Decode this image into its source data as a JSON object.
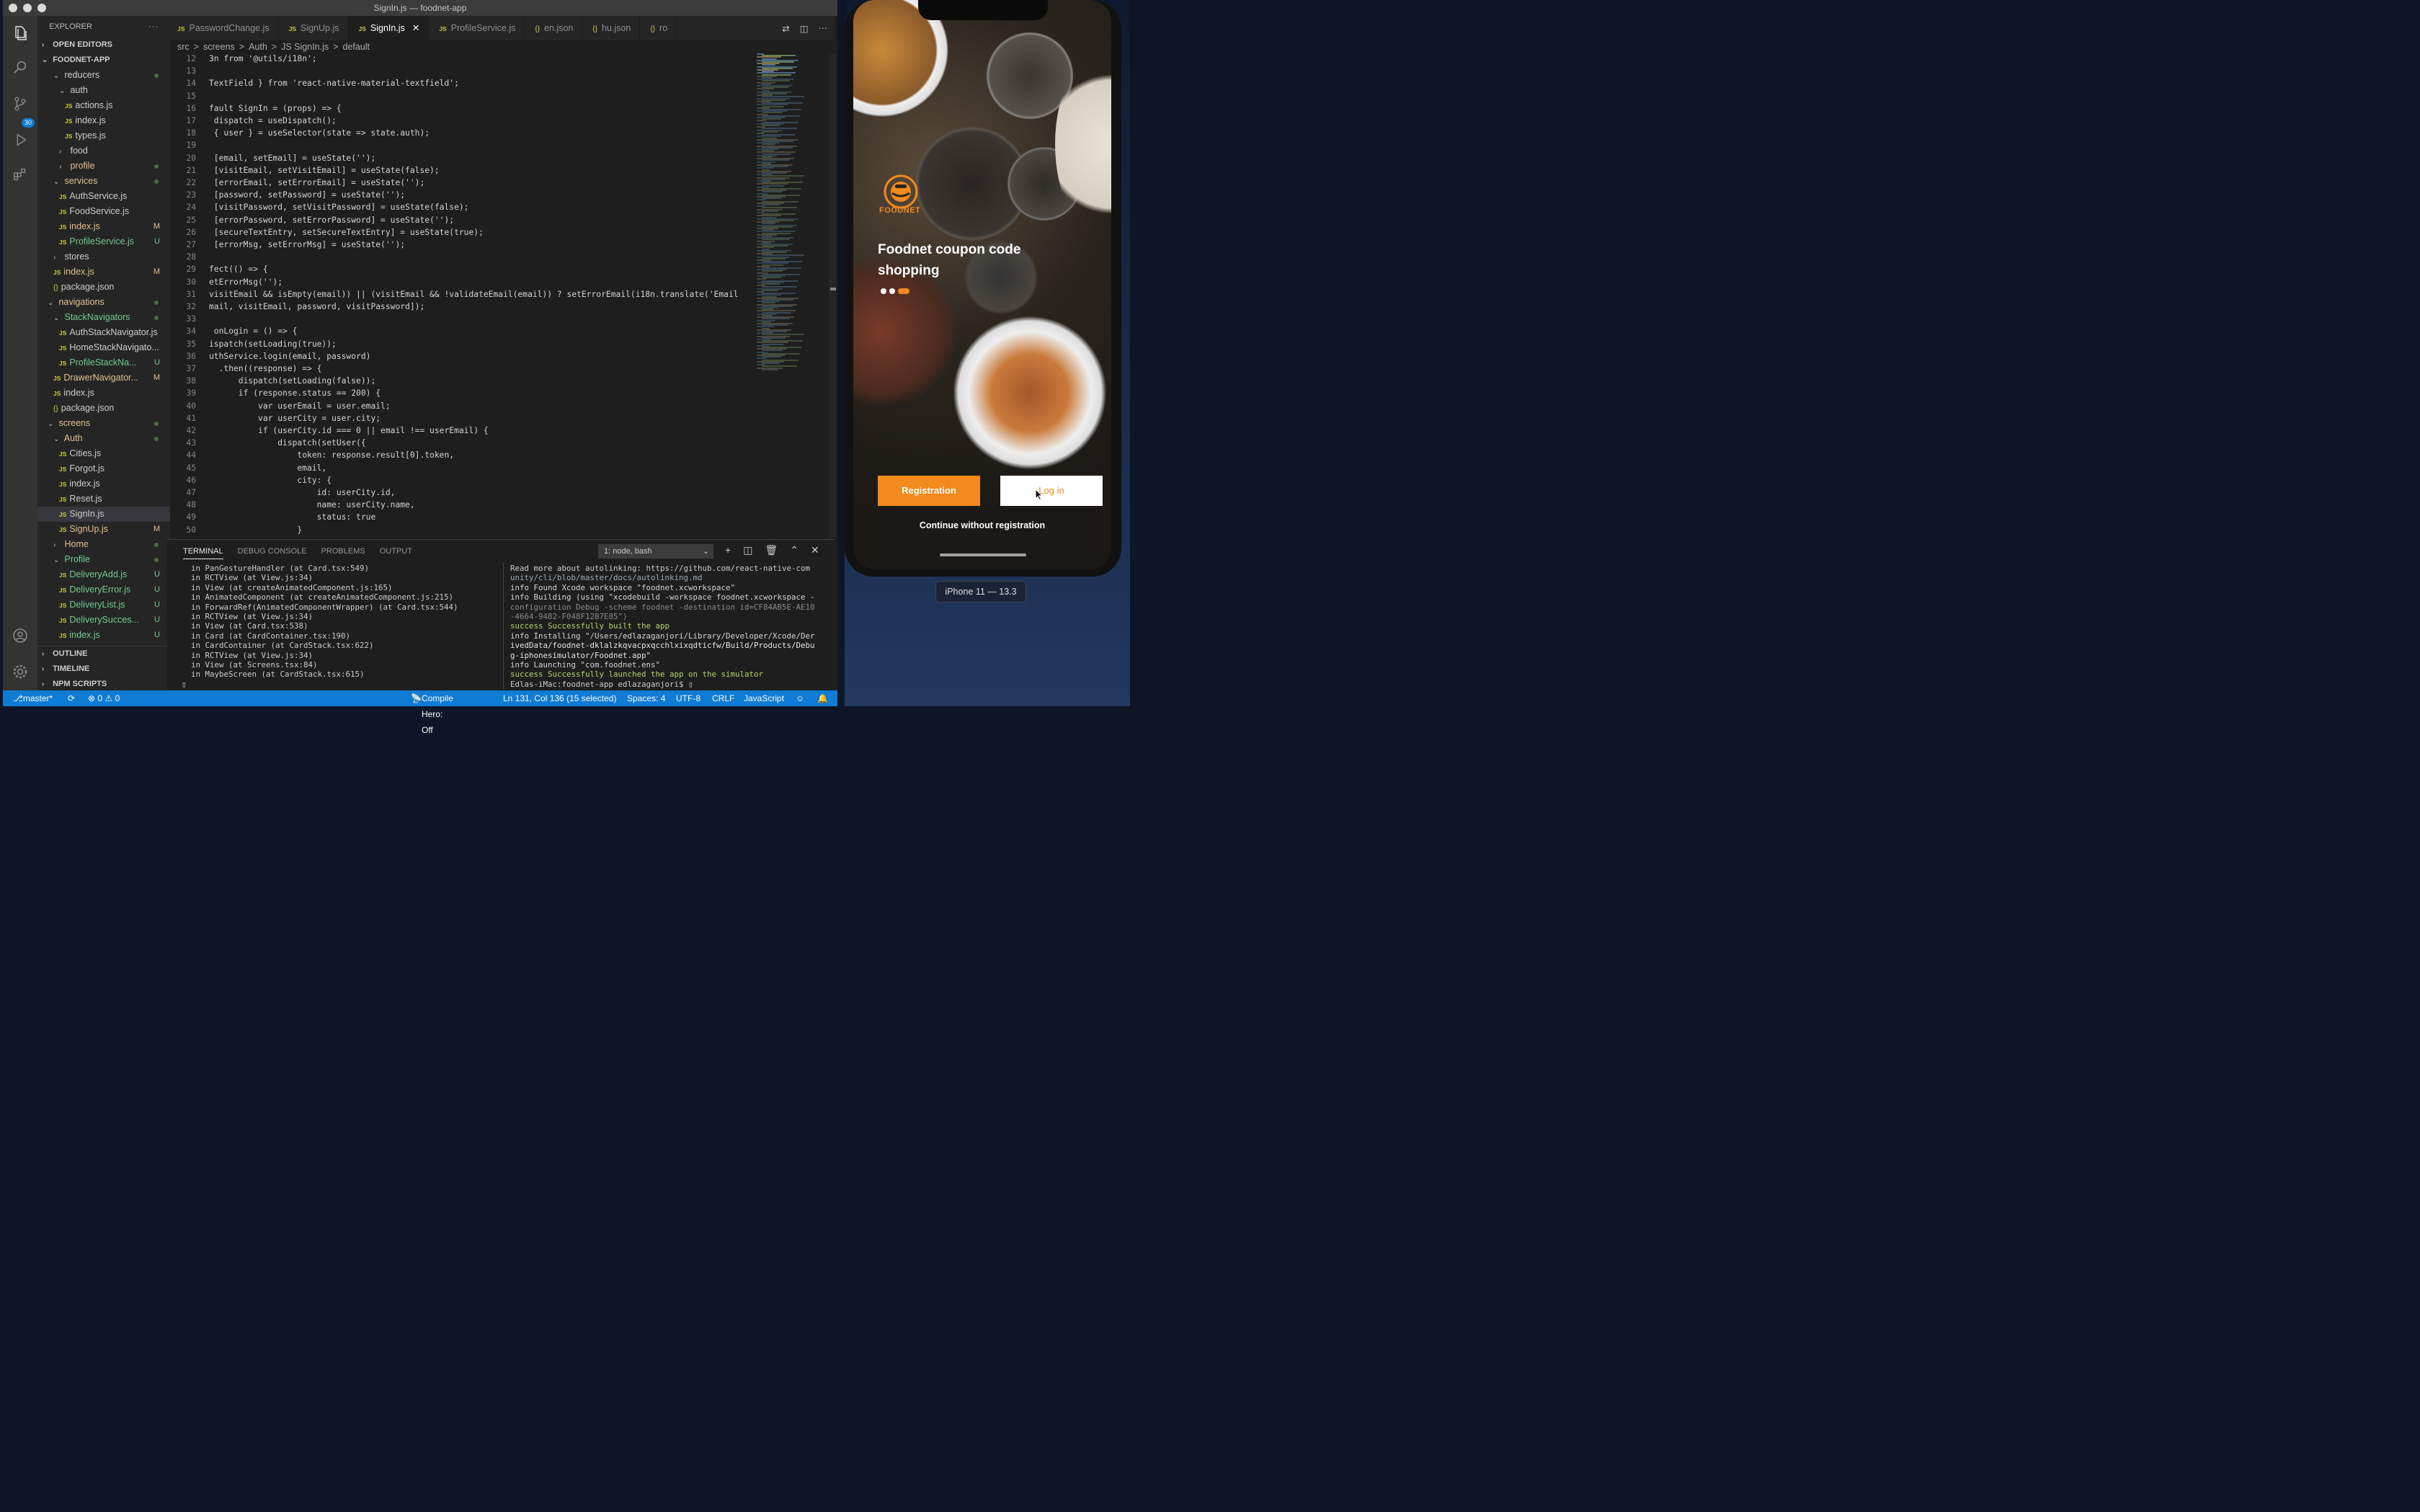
{
  "window": {
    "title": "SignIn.js — foodnet-app"
  },
  "explorer": {
    "title": "EXPLORER",
    "more": "···",
    "open_editors": "OPEN EDITORS",
    "project": "FOODNET-APP",
    "tree": [
      {
        "label": "reducers",
        "indent": 2,
        "type": "folder-open",
        "status": "dot"
      },
      {
        "label": "auth",
        "indent": 3,
        "type": "folder-open"
      },
      {
        "label": "actions.js",
        "indent": 4,
        "type": "js"
      },
      {
        "label": "index.js",
        "indent": 4,
        "type": "js"
      },
      {
        "label": "types.js",
        "indent": 4,
        "type": "js"
      },
      {
        "label": "food",
        "indent": 3,
        "type": "folder"
      },
      {
        "label": "profile",
        "indent": 3,
        "type": "folder",
        "status": "dot",
        "color": "yel"
      },
      {
        "label": "services",
        "indent": 2,
        "type": "folder-open",
        "status": "dot",
        "color": "yel"
      },
      {
        "label": "AuthService.js",
        "indent": 3,
        "type": "js"
      },
      {
        "label": "FoodService.js",
        "indent": 3,
        "type": "js"
      },
      {
        "label": "index.js",
        "indent": 3,
        "type": "js",
        "status": "M",
        "color": "yel"
      },
      {
        "label": "ProfileService.js",
        "indent": 3,
        "type": "js",
        "status": "U",
        "color": "green"
      },
      {
        "label": "stores",
        "indent": 2,
        "type": "folder"
      },
      {
        "label": "index.js",
        "indent": 2,
        "type": "js",
        "status": "M",
        "color": "yel"
      },
      {
        "label": "package.json",
        "indent": 2,
        "type": "json"
      },
      {
        "label": "navigations",
        "indent": 1,
        "type": "folder-open",
        "status": "dot",
        "color": "yel"
      },
      {
        "label": "StackNavigators",
        "indent": 2,
        "type": "folder-open",
        "status": "dot",
        "color": "green"
      },
      {
        "label": "AuthStackNavigator.js",
        "indent": 3,
        "type": "js"
      },
      {
        "label": "HomeStackNavigato...",
        "indent": 3,
        "type": "js"
      },
      {
        "label": "ProfileStackNa...",
        "indent": 3,
        "type": "js",
        "status": "U",
        "color": "green"
      },
      {
        "label": "DrawerNavigator...",
        "indent": 2,
        "type": "js",
        "status": "M",
        "color": "yel"
      },
      {
        "label": "index.js",
        "indent": 2,
        "type": "js"
      },
      {
        "label": "package.json",
        "indent": 2,
        "type": "json"
      },
      {
        "label": "screens",
        "indent": 1,
        "type": "folder-open",
        "status": "dot",
        "color": "yel"
      },
      {
        "label": "Auth",
        "indent": 2,
        "type": "folder-open",
        "status": "dot",
        "color": "yel"
      },
      {
        "label": "Cities.js",
        "indent": 3,
        "type": "js"
      },
      {
        "label": "Forgot.js",
        "indent": 3,
        "type": "js"
      },
      {
        "label": "index.js",
        "indent": 3,
        "type": "js"
      },
      {
        "label": "Reset.js",
        "indent": 3,
        "type": "js"
      },
      {
        "label": "SignIn.js",
        "indent": 3,
        "type": "js",
        "selected": true
      },
      {
        "label": "SignUp.js",
        "indent": 3,
        "type": "js",
        "status": "M",
        "color": "yel"
      },
      {
        "label": "Home",
        "indent": 2,
        "type": "folder",
        "status": "dot",
        "color": "yel"
      },
      {
        "label": "Profile",
        "indent": 2,
        "type": "folder-open",
        "status": "dot",
        "color": "green"
      },
      {
        "label": "DeliveryAdd.js",
        "indent": 3,
        "type": "js",
        "status": "U",
        "color": "green"
      },
      {
        "label": "DeliveryError.js",
        "indent": 3,
        "type": "js",
        "status": "U",
        "color": "green"
      },
      {
        "label": "DeliveryList.js",
        "indent": 3,
        "type": "js",
        "status": "U",
        "color": "green"
      },
      {
        "label": "DeliverySucces...",
        "indent": 3,
        "type": "js",
        "status": "U",
        "color": "green"
      },
      {
        "label": "index.js",
        "indent": 3,
        "type": "js",
        "status": "U",
        "color": "green"
      }
    ],
    "outline": "OUTLINE",
    "timeline": "TIMELINE",
    "npm": "NPM SCRIPTS"
  },
  "activity": {
    "scm_badge": "30"
  },
  "tabs": [
    {
      "label": "PasswordChange.js",
      "icon": "JS"
    },
    {
      "label": "SignUp.js",
      "icon": "JS"
    },
    {
      "label": "SignIn.js",
      "icon": "JS",
      "active": true
    },
    {
      "label": "ProfileService.js",
      "icon": "JS"
    },
    {
      "label": "en.json",
      "icon": "{}"
    },
    {
      "label": "hu.json",
      "icon": "{}"
    },
    {
      "label": "ro",
      "icon": "{}"
    }
  ],
  "breadcrumb": [
    "src",
    ">",
    "screens",
    ">",
    "Auth",
    ">",
    "JS SignIn.js",
    ">",
    "default"
  ],
  "code": [
    {
      "n": "12",
      "t": "3n from '@utils/i18n';"
    },
    {
      "n": "13",
      "t": ""
    },
    {
      "n": "14",
      "t": "TextField } from 'react-native-material-textfield';"
    },
    {
      "n": "15",
      "t": ""
    },
    {
      "n": "16",
      "t": "fault SignIn = (props) => {"
    },
    {
      "n": "17",
      "t": " dispatch = useDispatch();"
    },
    {
      "n": "18",
      "t": " { user } = useSelector(state => state.auth);"
    },
    {
      "n": "19",
      "t": ""
    },
    {
      "n": "20",
      "t": " [email, setEmail] = useState('');"
    },
    {
      "n": "21",
      "t": " [visitEmail, setVisitEmail] = useState(false);"
    },
    {
      "n": "22",
      "t": " [errorEmail, setErrorEmail] = useState('');"
    },
    {
      "n": "23",
      "t": " [password, setPassword] = useState('');"
    },
    {
      "n": "24",
      "t": " [visitPassword, setVisitPassword] = useState(false);"
    },
    {
      "n": "25",
      "t": " [errorPassword, setErrorPassword] = useState('');"
    },
    {
      "n": "26",
      "t": " [secureTextEntry, setSecureTextEntry] = useState(true);"
    },
    {
      "n": "27",
      "t": " [errorMsg, setErrorMsg] = useState('');"
    },
    {
      "n": "28",
      "t": ""
    },
    {
      "n": "29",
      "t": "fect(() => {"
    },
    {
      "n": "30",
      "t": "etErrorMsg('');"
    },
    {
      "n": "31",
      "t": "visitEmail && isEmpty(email)) || (visitEmail && !validateEmail(email)) ? setErrorEmail(i18n.translate('Email"
    },
    {
      "n": "32",
      "t": "mail, visitEmail, password, visitPassword]);"
    },
    {
      "n": "33",
      "t": ""
    },
    {
      "n": "34",
      "t": " onLogin = () => {"
    },
    {
      "n": "35",
      "t": "ispatch(setLoading(true));"
    },
    {
      "n": "36",
      "t": "uthService.login(email, password)"
    },
    {
      "n": "37",
      "t": "  .then((response) => {"
    },
    {
      "n": "38",
      "t": "      dispatch(setLoading(false));"
    },
    {
      "n": "39",
      "t": "      if (response.status == 200) {"
    },
    {
      "n": "40",
      "t": "          var userEmail = user.email;"
    },
    {
      "n": "41",
      "t": "          var userCity = user.city;"
    },
    {
      "n": "42",
      "t": "          if (userCity.id === 0 || email !== userEmail) {"
    },
    {
      "n": "43",
      "t": "              dispatch(setUser({"
    },
    {
      "n": "44",
      "t": "                  token: response.result[0].token,"
    },
    {
      "n": "45",
      "t": "                  email,"
    },
    {
      "n": "46",
      "t": "                  city: {"
    },
    {
      "n": "47",
      "t": "                      id: userCity.id,"
    },
    {
      "n": "48",
      "t": "                      name: userCity.name,"
    },
    {
      "n": "49",
      "t": "                      status: true"
    },
    {
      "n": "50",
      "t": "                  }"
    }
  ],
  "panel": {
    "tabs": [
      "TERMINAL",
      "DEBUG CONSOLE",
      "PROBLEMS",
      "OUTPUT"
    ],
    "terminal_select": "1: node, bash",
    "left_lines": [
      "  in PanGestureHandler (at Card.tsx:549)",
      "  in RCTView (at View.js:34)",
      "  in View (at createAnimatedComponent.js:165)",
      "  in AnimatedComponent (at createAnimatedComponent.js:215)",
      "  in ForwardRef(AnimatedComponentWrapper) (at Card.tsx:544)",
      "  in RCTView (at View.js:34)",
      "  in View (at Card.tsx:538)",
      "  in Card (at CardContainer.tsx:190)",
      "  in CardContainer (at CardStack.tsx:622)",
      "  in RCTView (at View.js:34)",
      "  in View (at Screens.tsx:84)",
      "  in MaybeScreen (at CardStack.tsx:615)",
      "▯"
    ],
    "right_lines": [
      "Read more about autolinking: https://github.com/react-native-com",
      "unity/cli/blob/master/docs/autolinking.md",
      "info Found Xcode workspace \"foodnet.xcworkspace\"",
      "info Building (using \"xcodebuild -workspace foodnet.xcworkspace -",
      "configuration Debug -scheme foodnet -destination id=CF84AB5E-AE10",
      "-4664-9482-F048F12B7E85\")",
      "success Successfully built the app",
      "info Installing \"/Users/edlazaganjori/Library/Developer/Xcode/Der",
      "ivedData/foodnet-dklalzkqvacpxqcchlxixqdticfw/Build/Products/Debu",
      "g-iphonesimulator/Foodnet.app\"",
      "info Launching \"com.foodnet.ens\"",
      "success Successfully launched the app on the simulator",
      "Edlas-iMac:foodnet-app edlazaganjori$ ▯"
    ]
  },
  "status": {
    "branch": "master*",
    "errors": "⊗ 0 ⚠ 0",
    "compile": "Compile Hero: Off",
    "position": "Ln 131, Col 136 (15 selected)",
    "spaces": "Spaces: 4",
    "encoding": "UTF-8",
    "eol": "CRLF",
    "language": "JavaScript"
  },
  "app": {
    "logo_text": "FOODNET",
    "headline": "Foodnet coupon code shopping",
    "register_button": "Registration",
    "login_button": "Log in",
    "continue_link": "Continue without registration",
    "accent": "#f28a1d"
  },
  "simulator": {
    "device_label": "iPhone 11 — 13.3"
  }
}
